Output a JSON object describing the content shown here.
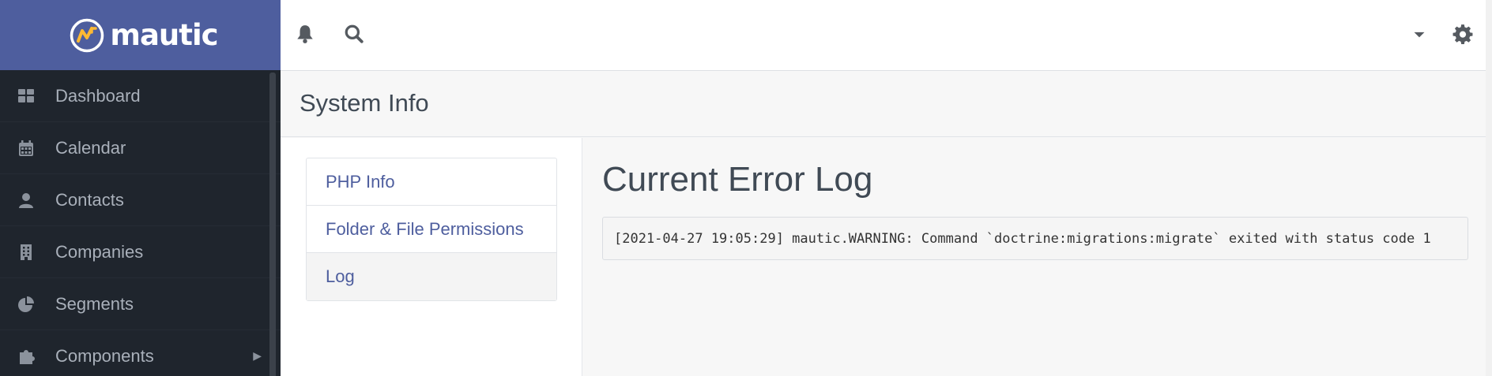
{
  "brand": {
    "name": "mautic",
    "accent": "#4e5e9e",
    "logo_accent": "#fdb933"
  },
  "sidebar": {
    "items": [
      {
        "label": "Dashboard",
        "icon": "dashboard-icon"
      },
      {
        "label": "Calendar",
        "icon": "calendar-icon"
      },
      {
        "label": "Contacts",
        "icon": "user-icon"
      },
      {
        "label": "Companies",
        "icon": "building-icon"
      },
      {
        "label": "Segments",
        "icon": "pie-chart-icon"
      },
      {
        "label": "Components",
        "icon": "puzzle-icon",
        "expandable": true
      }
    ]
  },
  "header": {
    "icons": [
      "bell-icon",
      "search-icon",
      "caret-down-icon",
      "gear-icon"
    ]
  },
  "page": {
    "title": "System Info"
  },
  "subnav": {
    "items": [
      {
        "label": "PHP Info"
      },
      {
        "label": "Folder & File Permissions"
      },
      {
        "label": "Log",
        "active": true
      }
    ]
  },
  "main": {
    "heading": "Current Error Log",
    "log_entry": "[2021-04-27 19:05:29] mautic.WARNING: Command `doctrine:migrations:migrate` exited with status code 1"
  }
}
